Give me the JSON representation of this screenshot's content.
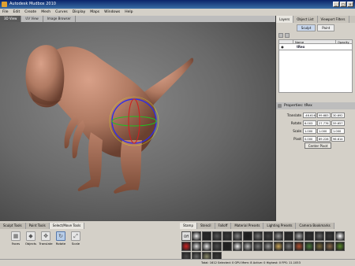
{
  "window": {
    "title": "Autodesk Mudbox 2010",
    "buttons": [
      "_",
      "□",
      "×"
    ]
  },
  "menu": [
    "File",
    "Edit",
    "Create",
    "Mesh",
    "Curves",
    "Display",
    "Maps",
    "Windows",
    "Help"
  ],
  "viewport_tabs": [
    {
      "label": "3D View",
      "active": true
    },
    {
      "label": "UV View",
      "active": false
    },
    {
      "label": "Image Browser",
      "active": false
    }
  ],
  "right_panel": {
    "tabs": [
      {
        "label": "Layers",
        "active": true
      },
      {
        "label": "Object List",
        "active": false
      },
      {
        "label": "Viewport Filters",
        "active": false
      }
    ],
    "subtabs": [
      {
        "label": "Sculpt",
        "active": true
      },
      {
        "label": "Paint",
        "active": false
      }
    ],
    "columns": {
      "name": "Name",
      "opacity": "Opacity"
    },
    "layer_name": "tRex",
    "properties_title": "Properties: tRex",
    "properties": [
      {
        "label": "Translate",
        "values": [
          "-46.616",
          "99.683",
          "30.692"
        ]
      },
      {
        "label": "Rotate",
        "values": [
          "6.003",
          "27.776",
          "59.657"
        ]
      },
      {
        "label": "Scale",
        "values": [
          "1.000",
          "1.000",
          "1.000"
        ]
      },
      {
        "label": "Pivot",
        "values": [
          "0.000",
          "89.228",
          "96.614"
        ]
      }
    ],
    "center_pivot": "Center Pivot"
  },
  "bottom_left": {
    "tabs": [
      {
        "label": "Sculpt Tools",
        "active": false
      },
      {
        "label": "Paint Tools",
        "active": false
      },
      {
        "label": "Select/Move Tools",
        "active": true
      }
    ],
    "tools": [
      {
        "label": "Faces",
        "icon": "faces-icon",
        "active": false
      },
      {
        "label": "Objects",
        "icon": "objects-icon",
        "active": false
      },
      {
        "label": "Translate",
        "icon": "translate-icon",
        "active": false
      },
      {
        "label": "Rotate",
        "icon": "rotate-icon",
        "active": true
      },
      {
        "label": "Scale",
        "icon": "scale-icon",
        "active": false
      }
    ]
  },
  "bottom_right": {
    "tabs": [
      {
        "label": "Stamp",
        "active": true
      },
      {
        "label": "Stencil",
        "active": false
      },
      {
        "label": "Falloff",
        "active": false
      },
      {
        "label": "Material Presets",
        "active": false
      },
      {
        "label": "Lighting Presets",
        "active": false
      },
      {
        "label": "Camera Bookmarks",
        "active": false
      }
    ],
    "off_label": "Off",
    "stamp_colors": [
      "#ececec",
      "#2a2a2a",
      "#5a5a5a",
      "#3a3a3a",
      "#888888",
      "#1e1e1e",
      "#777777",
      "#444444",
      "#999999",
      "#2e2e2e",
      "#b0b0b0",
      "#333333",
      "#6a6a6a",
      "#3b3b3b",
      "#ffffff",
      "#cc2222",
      "#dddddd",
      "#e6e6e6",
      "#505050",
      "#202020",
      "#eeeeee",
      "#bbbbbb",
      "#7a7a7a",
      "#9a9a9a",
      "#c8a45a",
      "#777777",
      "#b05030",
      "#4a7a3a",
      "#7a6a3a",
      "#8a6a4a",
      "#5a8a2a",
      "#4a4a4a",
      "#6a6a6a",
      "#8a8a6a",
      "#3a3a3a"
    ]
  },
  "status": "Total: 1612  Selected: 0  GPU Mem: 8  Active: 0  Highest: 0  FPS: 11.1053",
  "colors": {
    "model": "#b8806a",
    "manipulator": "#3a3aff"
  }
}
